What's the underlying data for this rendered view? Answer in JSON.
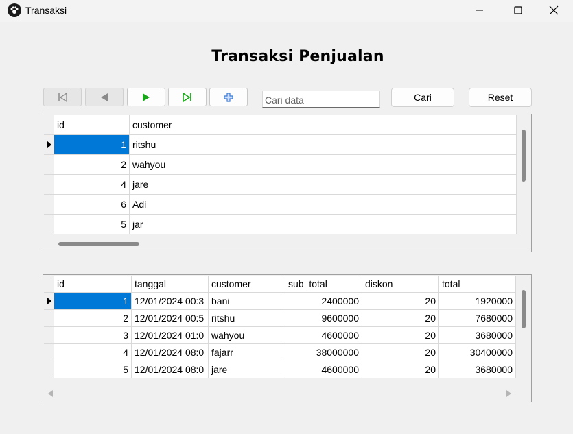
{
  "window": {
    "title": "Transaksi"
  },
  "heading": "Transaksi Penjualan",
  "toolbar": {
    "first_icon": "first-record-icon",
    "prev_icon": "previous-record-icon",
    "next_icon": "next-record-icon",
    "last_icon": "last-record-icon",
    "add_icon": "add-record-icon",
    "search_placeholder": "Cari data",
    "search_label": "Cari",
    "reset_label": "Reset"
  },
  "customer_grid": {
    "columns": [
      "id",
      "customer"
    ],
    "rows": [
      {
        "id": "1",
        "customer": "ritshu"
      },
      {
        "id": "2",
        "customer": "wahyou"
      },
      {
        "id": "4",
        "customer": "jare"
      },
      {
        "id": "6",
        "customer": "Adi"
      },
      {
        "id": "5",
        "customer": "jar"
      }
    ]
  },
  "transaction_grid": {
    "columns": [
      "id",
      "tanggal",
      "customer",
      "sub_total",
      "diskon",
      "total"
    ],
    "rows": [
      {
        "id": "1",
        "tanggal": "12/01/2024 00:3",
        "customer": "bani",
        "sub_total": "2400000",
        "diskon": "20",
        "total": "1920000"
      },
      {
        "id": "2",
        "tanggal": "12/01/2024 00:5",
        "customer": "ritshu",
        "sub_total": "9600000",
        "diskon": "20",
        "total": "7680000"
      },
      {
        "id": "3",
        "tanggal": "12/01/2024 01:0",
        "customer": "wahyou",
        "sub_total": "4600000",
        "diskon": "20",
        "total": "3680000"
      },
      {
        "id": "4",
        "tanggal": "12/01/2024 08:0",
        "customer": "fajarr",
        "sub_total": "38000000",
        "diskon": "20",
        "total": "30400000"
      },
      {
        "id": "5",
        "tanggal": "12/01/2024 08:0",
        "customer": "jare",
        "sub_total": "4600000",
        "diskon": "20",
        "total": "3680000"
      }
    ]
  },
  "colors": {
    "selection": "#0078d7",
    "nav_green": "#1aa61a",
    "add_blue": "#3a7bd5"
  }
}
